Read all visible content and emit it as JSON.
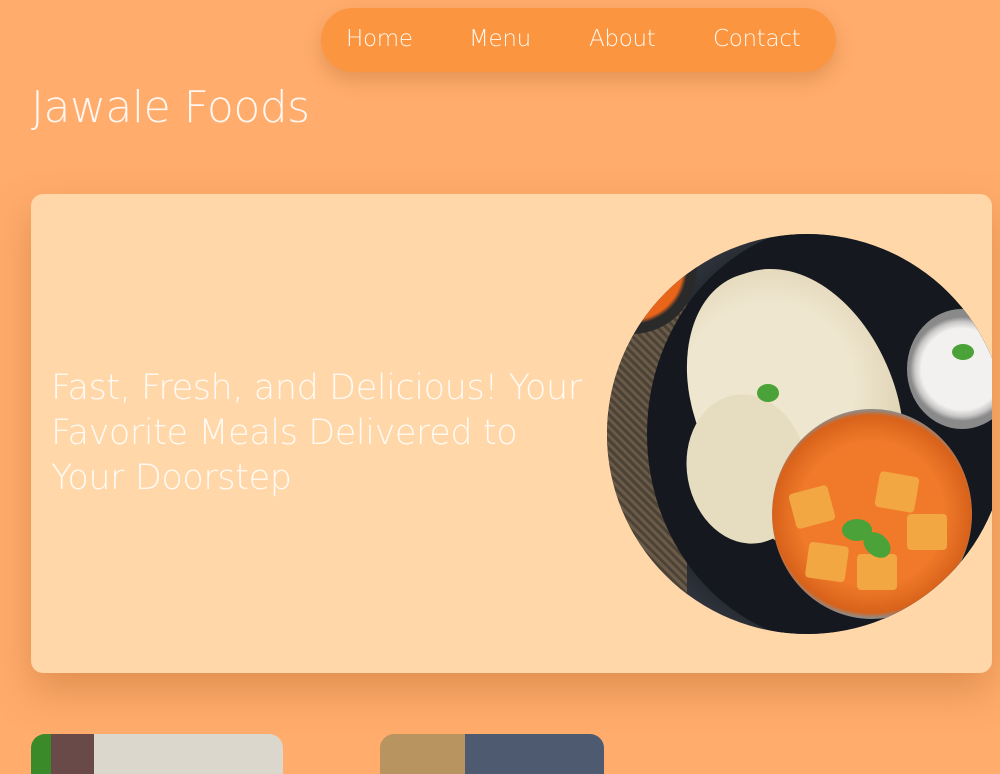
{
  "nav": {
    "items": [
      {
        "label": "Home"
      },
      {
        "label": "Menu"
      },
      {
        "label": "About"
      },
      {
        "label": "Contact"
      }
    ]
  },
  "brand": {
    "title": "Jawale Foods"
  },
  "hero": {
    "tagline": "Fast, Fresh, and Delicious! Your Favorite Meals Delivered to Your Doorstep",
    "image_alt": "paneer-curry-naan-plate"
  },
  "colors": {
    "background": "#ffac6c",
    "nav": "#fb953f",
    "hero_card": "#ffd7a8",
    "text": "#ffffff"
  }
}
